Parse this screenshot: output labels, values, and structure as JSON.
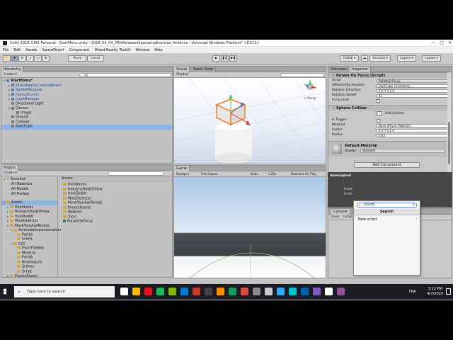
{
  "window": {
    "title": "Unity 2018.3.8f1 Personal - StartMenu.unity - 2018_04_04_XRIsReleasedSpacestrpExercise_Hololens - Universal Windows Platform* <DX11>",
    "controls": [
      "—",
      "□",
      "✕"
    ]
  },
  "menu": [
    "File",
    "Edit",
    "Assets",
    "GameObject",
    "Component",
    "Mixed Reality Toolkit",
    "Window",
    "Help"
  ],
  "toolbar": {
    "pivot": "Pivot",
    "local": "Local",
    "collab": "Collab ▾",
    "account": "Account ▾",
    "layers": "Layers ▾",
    "layout": "Layout ▾"
  },
  "hierarchy": {
    "tab": "Hierarchy",
    "create": "Create ▾",
    "search_placeholder": "All",
    "items": [
      {
        "label": "StartMenu*",
        "indent": 0,
        "type": "scene",
        "selected": false
      },
      {
        "label": "MixedRealityCameraParent",
        "indent": 1,
        "type": "prefab",
        "selected": false
      },
      {
        "label": "SpatialMapping",
        "indent": 1,
        "type": "prefab",
        "selected": false
      },
      {
        "label": "DefaultCursor",
        "indent": 1,
        "type": "prefab",
        "selected": false
      },
      {
        "label": "InputManager",
        "indent": 1,
        "type": "prefab",
        "selected": false
      },
      {
        "label": "Directional Light",
        "indent": 1,
        "type": "object",
        "selected": false
      },
      {
        "label": "Canvas",
        "indent": 1,
        "type": "object",
        "selected": false
      },
      {
        "label": "Image",
        "indent": 2,
        "type": "object",
        "selected": false
      },
      {
        "label": "Ground",
        "indent": 1,
        "type": "object",
        "selected": false
      },
      {
        "label": "Cylinder",
        "indent": 1,
        "type": "object",
        "selected": false
      },
      {
        "label": "StartCube",
        "indent": 1,
        "type": "object",
        "selected": true
      }
    ]
  },
  "scene": {
    "tabs": [
      "Scene",
      "Asset Store"
    ],
    "shading": "Shaded",
    "persp": "< Persp"
  },
  "game": {
    "tab": "Game",
    "display": "Display 1",
    "aspect": "Free Aspect",
    "scale": "Scale",
    "scale_value": "1.25x",
    "maximize": "Maximize On Play"
  },
  "project": {
    "tab": "Project",
    "create": "Create ▾",
    "favorites": {
      "label": "Favorites",
      "items": [
        "All Materials",
        "All Models",
        "All Prefabs"
      ]
    },
    "tree": [
      {
        "label": "Assets",
        "indent": 0,
        "selected": true
      },
      {
        "label": "HoloHands",
        "indent": 1,
        "selected": false
      },
      {
        "label": "HololensFieldOfView",
        "indent": 1,
        "selected": false
      },
      {
        "label": "HoloToolkit",
        "indent": 1,
        "selected": false
      },
      {
        "label": "MoreDetector",
        "indent": 1,
        "selected": false
      },
      {
        "label": "MoveYourAxeTeroids",
        "indent": 1,
        "selected": false
      },
      {
        "label": "AsteroidsImplementation",
        "indent": 2,
        "selected": false
      },
      {
        "label": "Prefab",
        "indent": 3,
        "selected": false
      },
      {
        "label": "Scene",
        "indent": 3,
        "selected": false
      },
      {
        "label": "CCC",
        "indent": 2,
        "selected": false
      },
      {
        "label": "FromTheWeb",
        "indent": 3,
        "selected": false
      },
      {
        "label": "Material",
        "indent": 3,
        "selected": false
      },
      {
        "label": "Prefab",
        "indent": 3,
        "selected": false
      },
      {
        "label": "RewiredLink",
        "indent": 3,
        "selected": false
      },
      {
        "label": "Scenes",
        "indent": 3,
        "selected": false
      },
      {
        "label": "Script",
        "indent": 3,
        "selected": false
      },
      {
        "label": "ProjectAssets",
        "indent": 1,
        "selected": false
      }
    ],
    "assets_header": "Assets",
    "assets": [
      "HoloHands",
      "HololensFieldOfView",
      "HoloToolkit",
      "MoreDetector",
      "MoveYourAxeTeroids",
      "ProjectAssets",
      "Rewired",
      "Tools",
      "RotateOnFocus"
    ]
  },
  "inspector": {
    "tabs": [
      "Dokumen",
      "Inspector"
    ],
    "rotate_component": {
      "title": "Rotate On Focus (Script)",
      "fields": [
        {
          "label": "Script",
          "value": "RotateOnFocus"
        },
        {
          "label": "Affected By Rotation",
          "value": "StartCube (Transform)"
        },
        {
          "label": "Rotation Direction",
          "value": "X 0    Y 0    Z 0"
        },
        {
          "label": "Rotation Speed",
          "value": "45"
        },
        {
          "label": "Is Focused",
          "value": ""
        }
      ]
    },
    "sphere_collider": {
      "title": "Sphere Collider",
      "edit": "Edit Collider",
      "fields": [
        {
          "label": "Is Trigger",
          "value": ""
        },
        {
          "label": "Material",
          "value": "None (Physic Material)"
        },
        {
          "label": "Center",
          "value": "X 0    Y 0    Z 0"
        },
        {
          "label": "Radius",
          "value": "0.83"
        }
      ]
    },
    "material": {
      "name": "Default-Material",
      "shader_label": "Shader",
      "shader": "Standard"
    },
    "add_component": "Add Component",
    "intercepted": "Intercepted",
    "rotat": "Rotat",
    "onfo": "OnFo"
  },
  "popup": {
    "search_value": "StartM",
    "header": "Search",
    "items": [
      "New script"
    ]
  },
  "console": {
    "tab": "Console",
    "clear": "Clear",
    "collapse": "Collap"
  },
  "taskbar": {
    "search_placeholder": "Type here to search",
    "time": "3:11 PM",
    "date": "4/7/2019",
    "lang": "FRA",
    "app_colors": [
      "#ffffff",
      "#ffb900",
      "#e81123",
      "#1db954",
      "#7fba00",
      "#0078d7",
      "#c23b22",
      "#444444",
      "#ff8c00",
      "#0f9d58",
      "#dd4b39",
      "#8a8a8a",
      "#cccccc",
      "#31a8ff",
      "#00c4cc",
      "#0063b1",
      "#7e57c2",
      "#ffffff",
      "#9b4f96"
    ]
  }
}
